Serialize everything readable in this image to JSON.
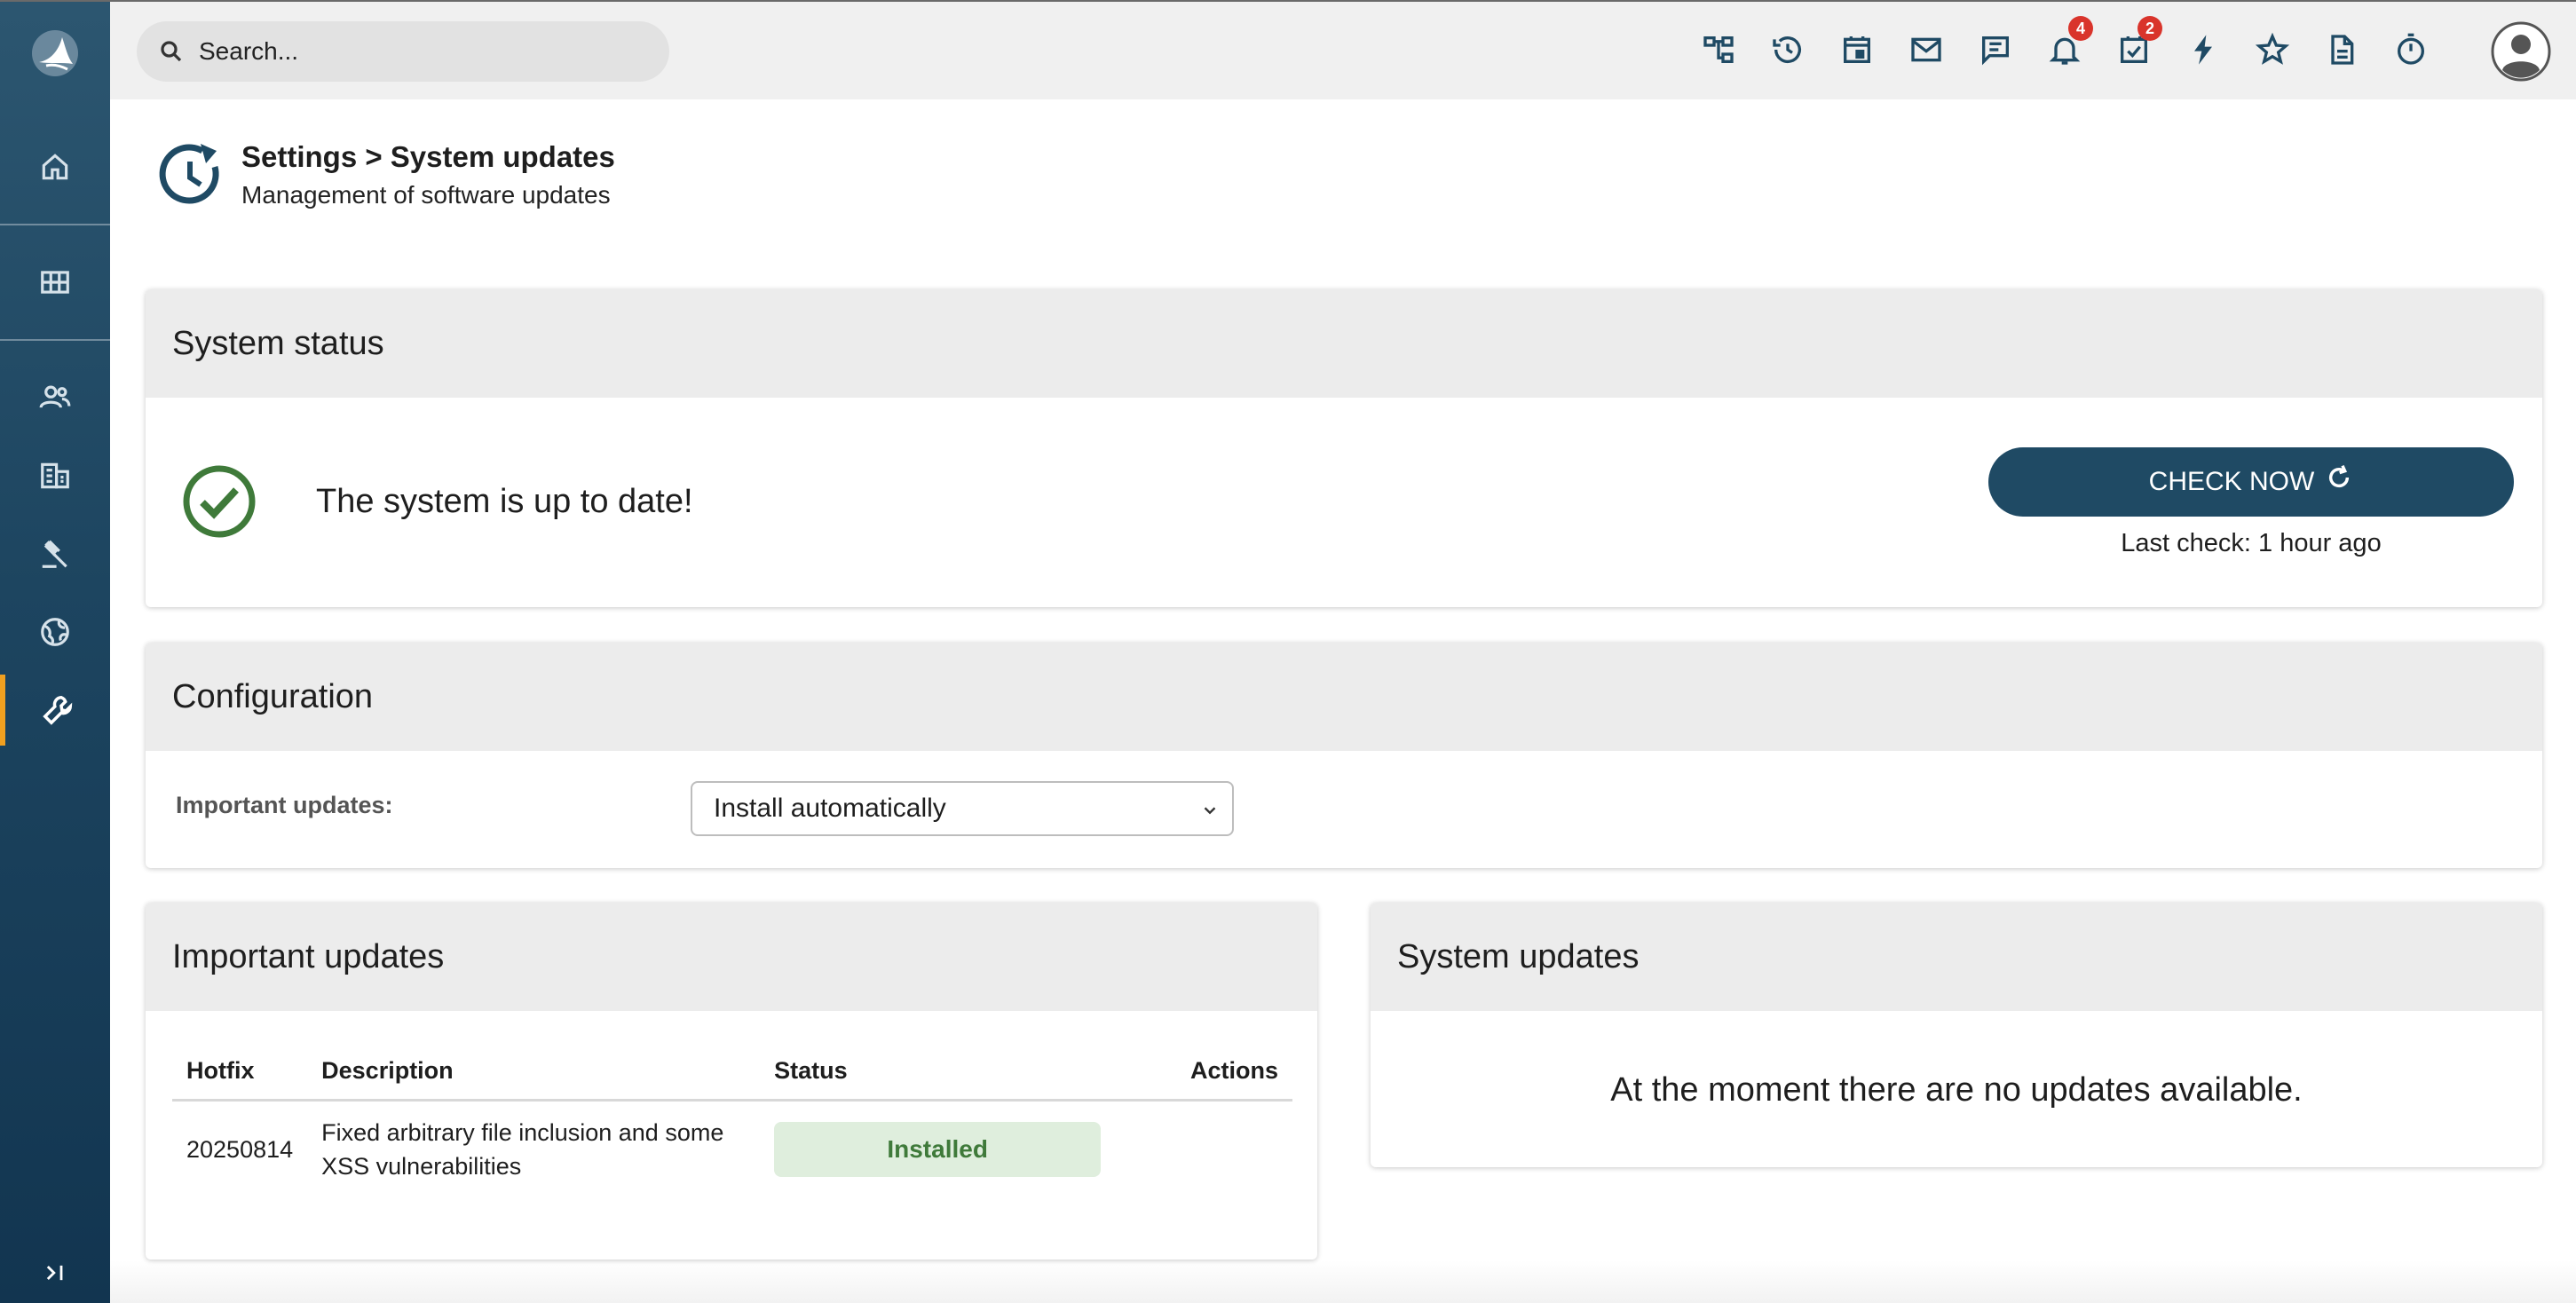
{
  "colors": {
    "sidebar": "#1d4560",
    "accent_active": "#f0a020",
    "primary_button": "#1f4a64",
    "success": "#3f7a3a",
    "badge": "#d9342b"
  },
  "sidebar": {
    "items": [
      {
        "icon": "home-icon"
      },
      {
        "icon": "grid-icon"
      },
      {
        "icon": "users-icon"
      },
      {
        "icon": "building-icon"
      },
      {
        "icon": "gavel-icon"
      },
      {
        "icon": "globe-icon"
      },
      {
        "icon": "wrench-icon",
        "active": true
      }
    ],
    "collapse_label": ">|"
  },
  "topbar": {
    "search_placeholder": "Search...",
    "icons": [
      "sitemap-icon",
      "history-icon",
      "calendar-icon",
      "mail-icon",
      "chat-icon",
      "bell-icon",
      "task-icon",
      "bolt-icon",
      "star-icon",
      "document-icon",
      "timer-icon"
    ],
    "notifications_count": "4",
    "tasks_count": "2"
  },
  "page": {
    "title": "Settings > System updates",
    "subtitle": "Management of software updates"
  },
  "system_status": {
    "heading": "System status",
    "message": "The system is up to date!",
    "check_button": "CHECK NOW",
    "last_check": "Last check: 1 hour ago"
  },
  "configuration": {
    "heading": "Configuration",
    "label": "Important updates:",
    "selected": "Install automatically"
  },
  "important_updates": {
    "heading": "Important updates",
    "columns": [
      "Hotfix",
      "Description",
      "Status",
      "Actions"
    ],
    "rows": [
      {
        "hotfix": "20250814",
        "description": "Fixed arbitrary file inclusion and some XSS vulnerabilities",
        "status": "Installed"
      }
    ]
  },
  "system_updates": {
    "heading": "System updates",
    "message": "At the moment there are no updates available."
  }
}
